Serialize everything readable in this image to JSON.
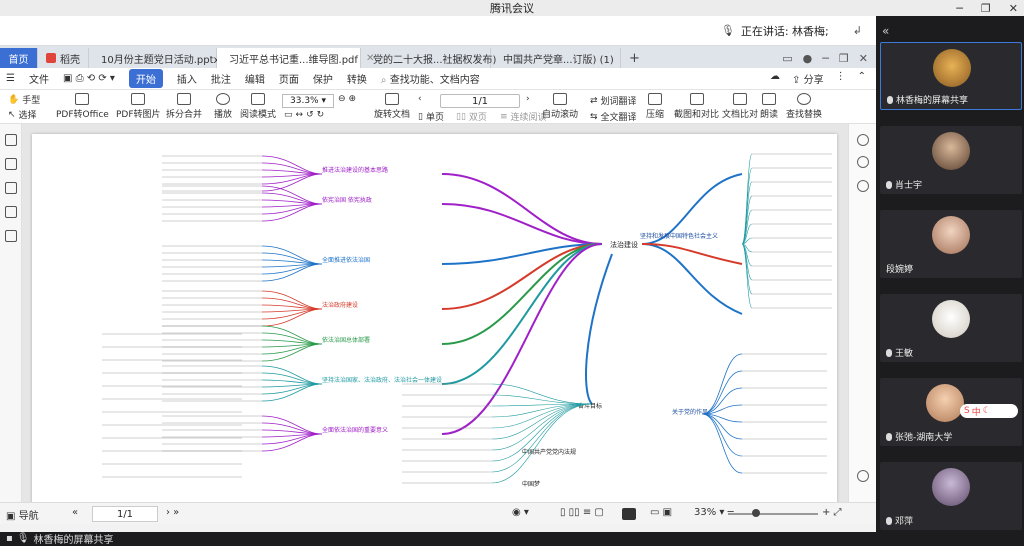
{
  "meeting": {
    "title": "腾讯会议",
    "speaking_prefix": "正在讲话: 林香梅;",
    "screen_share_label": "林香梅的屏幕共享"
  },
  "tabs": [
    {
      "label": "首页",
      "color": "#3b6fd4"
    },
    {
      "label": "稻壳",
      "color": "#e0443a"
    },
    {
      "label": "10月份主题党日活动.pptx",
      "color": "#e76f2b"
    },
    {
      "label": "习近平总书记重...维导图.pdf",
      "color": "#d23b2f"
    },
    {
      "label": "党的二十大报...社据权发布)",
      "color": "#2b6bd6"
    },
    {
      "label": "中国共产党章...订版) (1)",
      "color": "#2b6bd6"
    }
  ],
  "menu": {
    "file": "文件",
    "start": "开始",
    "insert": "插入",
    "annotate": "批注",
    "edit": "编辑",
    "page": "页面",
    "protect": "保护",
    "convert": "转换",
    "search_placeholder": "查找功能、文档内容",
    "share": "分享"
  },
  "toolbar": {
    "hand": "手型",
    "select": "选择",
    "pdf_to_office": "PDF转Office",
    "pdf_to_image": "PDF转图片",
    "split_merge": "拆分合并",
    "play": "播放",
    "read_mode": "阅读模式",
    "zoom": "33.3%",
    "rotate_doc": "旋转文档",
    "page_indicator": "1/1",
    "single_page": "单页",
    "double_page": "双页",
    "continuous": "连续阅读",
    "auto_scroll": "自动滚动",
    "underline_translate": "划词翻译",
    "full_translate": "全文翻译",
    "compress": "压缩",
    "screenshot_compare": "截图和对比",
    "doc_compare": "文档比对",
    "read_aloud": "朗读",
    "find_replace": "查找替换"
  },
  "statusbar": {
    "nav": "导航",
    "page": "1/1",
    "zoom": "33%"
  },
  "mindmap": {
    "center_label": "法治建设",
    "right_top_label": "坚持和发展中国特色社会主义",
    "right_bottom_label": "关于党的作风",
    "left_nodes": [
      "推进法治建设的基本思路",
      "依宪治国 依宪执政",
      "全面推进依法治国",
      "法治政府建设",
      "依法治国总体部署",
      "坚持法治国家、法治政府、法治社会一体建设",
      "全面依法治国的重要意义"
    ],
    "bottom_labels": [
      "奋斗目标",
      "中国共产党党内法规",
      "中国梦"
    ]
  },
  "participants": [
    {
      "name": "林香梅的屏幕共享",
      "avatar_color": "#c98a3a"
    },
    {
      "name": "肖士宇",
      "avatar_color": "#6b4f3f"
    },
    {
      "name": "段婉婷",
      "avatar_color": "#b7876b"
    },
    {
      "name": "王敏",
      "avatar_color": "#ece9e4"
    },
    {
      "name": "张弛-湖南大学",
      "avatar_color": "#e4b48e"
    },
    {
      "name": "邓萍",
      "avatar_color": "#7e6e8e"
    }
  ],
  "sogou_text": "中",
  "colors": {
    "accent": "#3b6fd4",
    "branch_purple": "#a020c8",
    "branch_blue": "#1e73c8",
    "branch_red": "#d63a2a",
    "branch_green": "#2a9a4a",
    "branch_teal": "#1f9aa0"
  }
}
